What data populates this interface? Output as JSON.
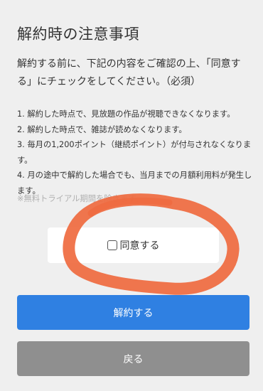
{
  "page": {
    "title": "解約時の注意事項",
    "intro": "解約する前に、下記の内容をご確認の上、「同意する」にチェックをしてください。（必須）"
  },
  "notes": [
    "1. 解約した時点で、見放題の作品が視聴できなくなります。",
    "2. 解約した時点で、雑誌が読めなくなります。",
    "3. 毎月の1,200ポイント（継続ポイント）が付与されなくなります。",
    "4. 月の途中で解約した場合でも、当月までの月額利用料が発生します。"
  ],
  "remark": "※無料トライアル期間を除きます。",
  "agreement": {
    "label": "同意する",
    "checked": false
  },
  "buttons": {
    "cancel_label": "解約する",
    "back_label": "戻る"
  },
  "colors": {
    "background": "#efefef",
    "primary": "#2f80e2",
    "secondary": "#8f8f8f",
    "annotation": "#ef6a3f"
  }
}
